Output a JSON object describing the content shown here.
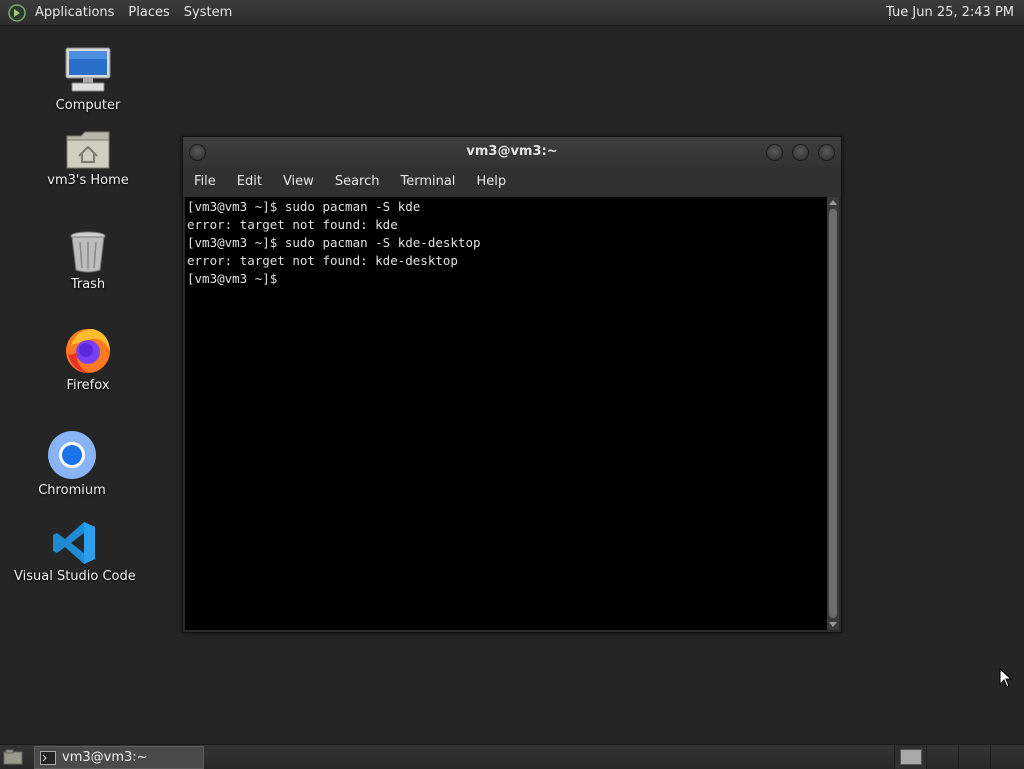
{
  "top_panel": {
    "menus": [
      "Applications",
      "Places",
      "System"
    ],
    "clock": "Tue Jun 25,  2:43 PM"
  },
  "desktop_icons": [
    {
      "label": "Computer",
      "icon": "computer-icon"
    },
    {
      "label": "vm3's Home",
      "icon": "home-folder-icon"
    },
    {
      "label": "Trash",
      "icon": "trash-icon"
    },
    {
      "label": "Firefox",
      "icon": "firefox-icon"
    },
    {
      "label": "Chromium",
      "icon": "chromium-icon"
    },
    {
      "label": "Visual Studio Code",
      "icon": "vscode-icon"
    }
  ],
  "terminal": {
    "title": "vm3@vm3:~",
    "menu": [
      "File",
      "Edit",
      "View",
      "Search",
      "Terminal",
      "Help"
    ],
    "lines": [
      "[vm3@vm3 ~]$ sudo pacman -S kde",
      "error: target not found: kde",
      "[vm3@vm3 ~]$ sudo pacman -S kde-desktop",
      "error: target not found: kde-desktop",
      "[vm3@vm3 ~]$ "
    ]
  },
  "taskbar": {
    "window_label": "vm3@vm3:~"
  },
  "colors": {
    "desktop_bg": "#252525",
    "terminal_bg": "#000000",
    "terminal_fg": "#e0e0e0"
  }
}
